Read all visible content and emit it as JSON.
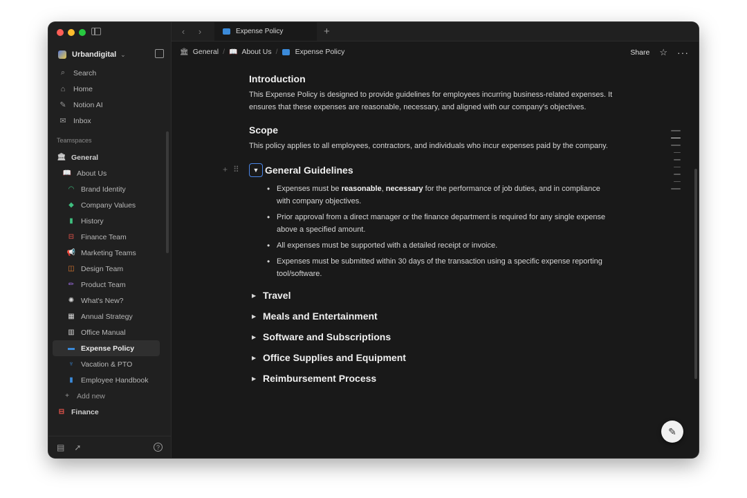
{
  "workspace": {
    "name": "Urbandigital"
  },
  "nav": [
    {
      "label": "Search",
      "icon": "⌕"
    },
    {
      "label": "Home",
      "icon": "⌂"
    },
    {
      "label": "Notion AI",
      "icon": "✎"
    },
    {
      "label": "Inbox",
      "icon": "✉"
    }
  ],
  "teamspaces_label": "Teamspaces",
  "tree": [
    {
      "label": "General",
      "level": 0,
      "icon": "🏛",
      "color": "#cfcfcf"
    },
    {
      "label": "About Us",
      "level": 1,
      "icon": "📖",
      "color": "#cfcfcf"
    },
    {
      "label": "Brand Identity",
      "level": 2,
      "icon": "◠",
      "color": "#3fbf7f"
    },
    {
      "label": "Company Values",
      "level": 2,
      "icon": "◆",
      "color": "#3fbf7f"
    },
    {
      "label": "History",
      "level": 2,
      "icon": "▮",
      "color": "#3fbf7f"
    },
    {
      "label": "Finance Team",
      "level": 2,
      "icon": "⊟",
      "color": "#e5534b"
    },
    {
      "label": "Marketing Teams",
      "level": 2,
      "icon": "📢",
      "color": "#e0a030"
    },
    {
      "label": "Design Team",
      "level": 2,
      "icon": "◫",
      "color": "#e07a30"
    },
    {
      "label": "Product Team",
      "level": 2,
      "icon": "✏",
      "color": "#9b6be0"
    },
    {
      "label": "What's New?",
      "level": 2,
      "icon": "✺",
      "color": "#d8d8d8"
    },
    {
      "label": "Annual Strategy",
      "level": 2,
      "icon": "▦",
      "color": "#d8d8d8"
    },
    {
      "label": "Office Manual",
      "level": 2,
      "icon": "▥",
      "color": "#d8d8d8"
    },
    {
      "label": "Expense Policy",
      "level": 2,
      "icon": "▬",
      "color": "#3b8ad9",
      "active": true
    },
    {
      "label": "Vacation & PTO",
      "level": 2,
      "icon": "♆",
      "color": "#3b8ad9"
    },
    {
      "label": "Employee Handbook",
      "level": 2,
      "icon": "▮",
      "color": "#3b8ad9"
    },
    {
      "label": "Add new",
      "level": 1,
      "icon": "+",
      "color": "#9a9a9a"
    },
    {
      "label": "Finance",
      "level": 0,
      "icon": "⊟",
      "color": "#e5534b"
    }
  ],
  "tab": {
    "title": "Expense Policy"
  },
  "breadcrumb": [
    {
      "label": "General",
      "icon": "🏛"
    },
    {
      "label": "About Us",
      "icon": "📖"
    },
    {
      "label": "Expense Policy",
      "icon": "▬"
    }
  ],
  "topbar": {
    "share_label": "Share"
  },
  "doc": {
    "intro_title": "Introduction",
    "intro_text": "This Expense Policy is designed to provide guidelines for employees incurring business-related expenses. It ensures that these expenses are reasonable, necessary, and aligned with our company's objectives.",
    "scope_title": "Scope",
    "scope_text": "This policy applies to all employees, contractors, and individuals who incur expenses paid by the company.",
    "guidelines_title": "General Guidelines",
    "bullets": [
      {
        "pre": "Expenses must be ",
        "bold1": "reasonable",
        "mid": ", ",
        "bold2": "necessary",
        "post": " for the performance of job duties, and in compliance with company objectives."
      },
      {
        "pre": "Prior approval from a direct manager or the finance department is required for any single expense above a specified amount."
      },
      {
        "pre": "All expenses must be supported with a detailed receipt or invoice."
      },
      {
        "pre": "Expenses must be submitted within 30 days of the transaction using a specific expense reporting tool/software."
      }
    ],
    "toggles": [
      "Travel",
      "Meals and Entertainment",
      "Software and Subscriptions",
      "Office Supplies and Equipment",
      "Reimbursement Process"
    ]
  }
}
